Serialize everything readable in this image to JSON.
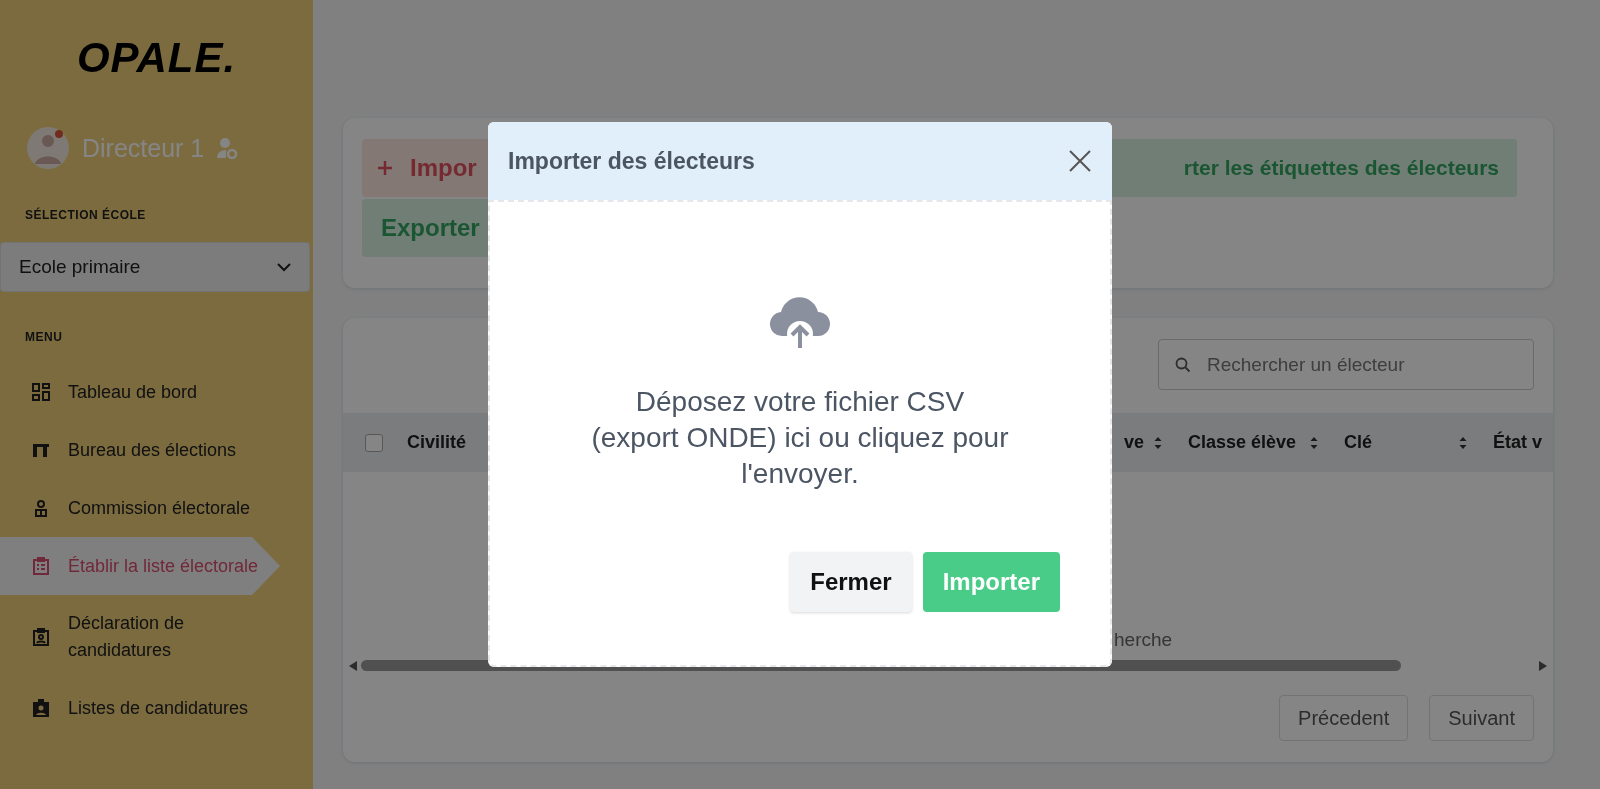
{
  "sidebar": {
    "logo": "OPALE.",
    "user": {
      "name": "Directeur 1"
    },
    "school_section": {
      "label": "SÉLECTION ÉCOLE",
      "select": {
        "value": "Ecole primaire"
      }
    },
    "menu": {
      "label": "MENU",
      "items": [
        {
          "label": "Tableau de bord",
          "selected": false
        },
        {
          "label": "Bureau des élections",
          "selected": false
        },
        {
          "label": "Commission électorale",
          "selected": false
        },
        {
          "label": "Établir la liste électorale",
          "selected": true
        },
        {
          "label": "Déclaration de candidatures",
          "selected": false
        },
        {
          "label": "Listes de candidatures",
          "selected": false
        }
      ]
    }
  },
  "toolbar": {
    "buttons": [
      {
        "label": "Impor",
        "kind": "add"
      },
      {
        "label": "rter les étiquettes des électeurs",
        "kind": "export"
      },
      {
        "label": "Exporter",
        "kind": "export"
      }
    ]
  },
  "voters": {
    "search": {
      "placeholder": "Rechercher un électeur"
    },
    "table": {
      "select_all": {
        "checked": false
      },
      "columns": [
        {
          "label": "Civilité",
          "sortable": false
        },
        {
          "label": "ve",
          "sortable": true
        },
        {
          "label": "Classe élève",
          "sortable": true
        },
        {
          "label": "Clé",
          "sortable": true
        },
        {
          "label": "État v",
          "sortable": false
        }
      ],
      "empty_message": "herche"
    },
    "pagination": [
      "Précedent",
      "Suivant"
    ]
  },
  "modal": {
    "title": "Importer des électeurs",
    "dropzone_text": "Déposez votre fichier CSV (export ONDE) ici ou cliquez pour l'envoyer.",
    "buttons": [
      {
        "label": "Fermer",
        "kind": "secondary"
      },
      {
        "label": "Importer",
        "kind": "primary"
      }
    ]
  }
}
